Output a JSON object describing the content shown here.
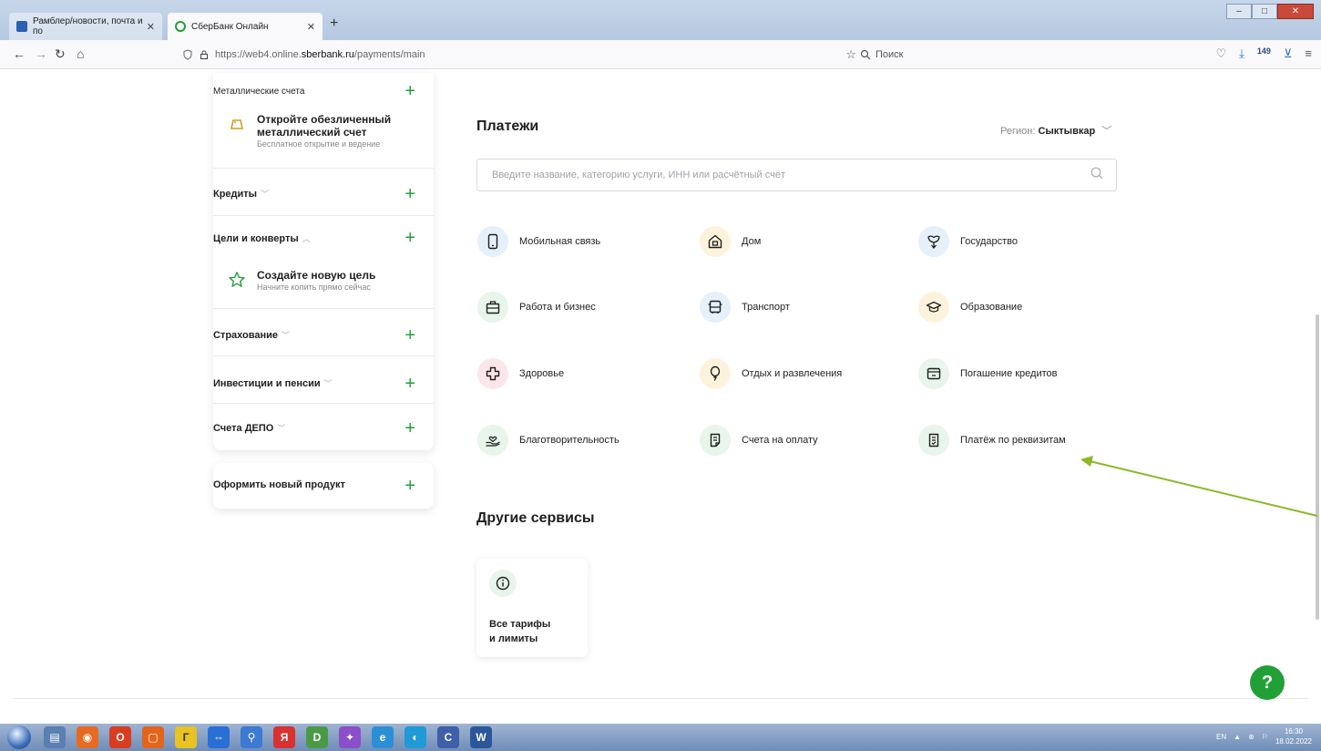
{
  "browser": {
    "tabs": [
      {
        "label": "Рамблер/новости, почта и по"
      },
      {
        "label": "СберБанк Онлайн"
      }
    ],
    "url_prefix": "https://web4.online.",
    "url_domain": "sberbank.ru",
    "url_path": "/payments/main",
    "search_placeholder": "Поиск",
    "badge_count": "149"
  },
  "sidebar": {
    "metal": {
      "title": "Металлические счета",
      "promo_title": "Откройте обезличенный металлический счет",
      "promo_subtitle": "Бесплатное открытие и ведение"
    },
    "credits": {
      "title": "Кредиты"
    },
    "goals": {
      "title": "Цели и конверты",
      "promo_title": "Создайте новую цель",
      "promo_subtitle": "Начните копить прямо сейчас"
    },
    "insurance": {
      "title": "Страхование"
    },
    "investments": {
      "title": "Инвестиции и пенсии"
    },
    "depo": {
      "title": "Счета ДЕПО"
    },
    "new_product": {
      "title": "Оформить новый продукт"
    }
  },
  "payments": {
    "title": "Платежи",
    "region_label": "Регион:",
    "region_value": "Сыктывкар",
    "search_placeholder": "Введите название, категорию услуги, ИНН или расчётный счёт",
    "categories": [
      {
        "label": "Мобильная связь",
        "icon": "phone-icon"
      },
      {
        "label": "Дом",
        "icon": "house-icon"
      },
      {
        "label": "Государство",
        "icon": "emblem-icon"
      },
      {
        "label": "Работа и бизнес",
        "icon": "briefcase-icon"
      },
      {
        "label": "Транспорт",
        "icon": "bus-icon"
      },
      {
        "label": "Образование",
        "icon": "graduation-cap-icon"
      },
      {
        "label": "Здоровье",
        "icon": "medical-cross-icon"
      },
      {
        "label": "Отдых и развлечения",
        "icon": "balloon-icon"
      },
      {
        "label": "Погашение кредитов",
        "icon": "wallet-icon"
      },
      {
        "label": "Благотворительность",
        "icon": "heart-hand-icon"
      },
      {
        "label": "Счета на оплату",
        "icon": "invoice-icon"
      },
      {
        "label": "Платёж по реквизитам",
        "icon": "receipt-icon"
      }
    ]
  },
  "other_services": {
    "title": "Другие сервисы",
    "card_line1": "Все тарифы",
    "card_line2": "и лимиты"
  },
  "help": {
    "label": "?"
  },
  "taskbar": {
    "lang": "EN",
    "time": "16:30",
    "date": "18.02.2022"
  },
  "colors": {
    "brand_green": "#21a038",
    "annotation_arrow": "#8ab826"
  }
}
